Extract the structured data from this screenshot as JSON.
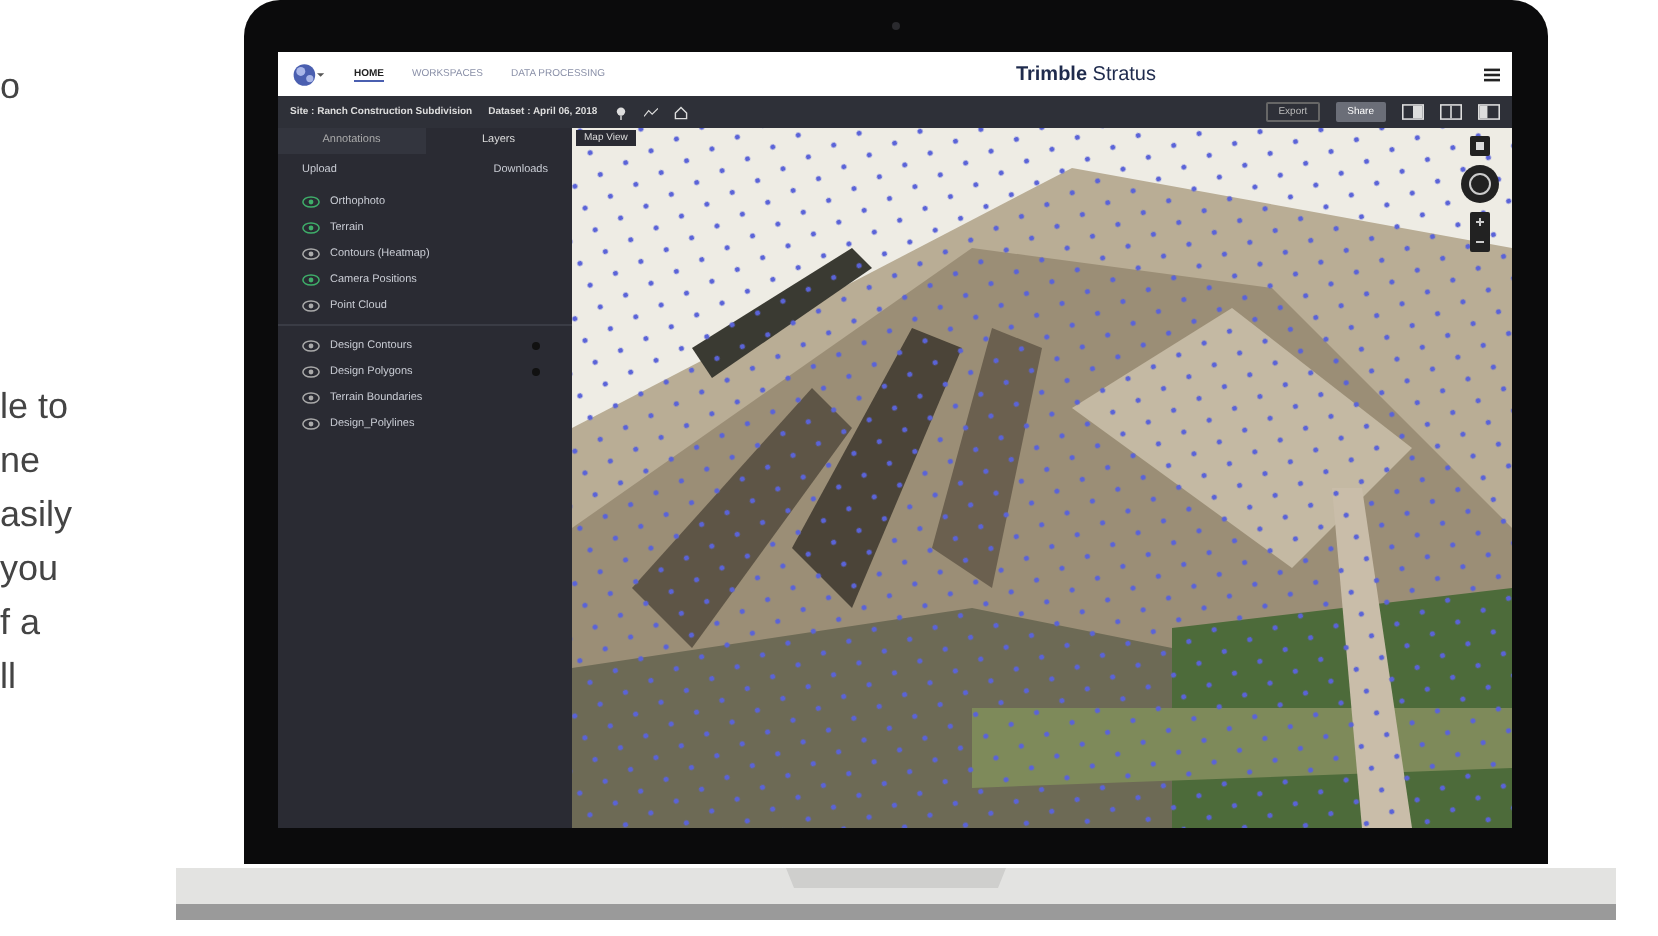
{
  "side_text": {
    "heading_fragment": "o",
    "paragraph_lines": [
      "le to",
      "ne",
      "asily",
      "you",
      "f a",
      "ll"
    ]
  },
  "app": {
    "nav": [
      {
        "label": "HOME",
        "selected": true
      },
      {
        "label": "WORKSPACES",
        "selected": false
      },
      {
        "label": "DATA PROCESSING",
        "selected": false
      }
    ],
    "brand": {
      "bold": "Trimble",
      "light": "Stratus"
    },
    "breadcrumb": {
      "site": "Site : Ranch Construction Subdivision",
      "dataset": "Dataset : April 06, 2018"
    },
    "actions": [
      {
        "label": "Export",
        "selected": false
      },
      {
        "label": "Share",
        "selected": true
      }
    ],
    "panel_tabs": [
      {
        "label": "Annotations",
        "selected": false
      },
      {
        "label": "Layers",
        "selected": true
      }
    ],
    "upload": "Upload",
    "downloads": "Downloads",
    "layers": [
      {
        "name": "Orthophoto",
        "on": true
      },
      {
        "name": "Terrain",
        "on": true
      },
      {
        "name": "Contours (Heatmap)",
        "on": false
      },
      {
        "name": "Camera Positions",
        "on": true
      },
      {
        "name": "Point Cloud",
        "on": false
      }
    ],
    "design_layers": [
      {
        "name": "Design Contours",
        "on": false,
        "color": "#111111"
      },
      {
        "name": "Design Polygons",
        "on": false,
        "color": "#111111"
      },
      {
        "name": "Terrain Boundaries",
        "on": false
      },
      {
        "name": "Design_Polylines",
        "on": false
      }
    ],
    "map_tab": "Map View"
  }
}
